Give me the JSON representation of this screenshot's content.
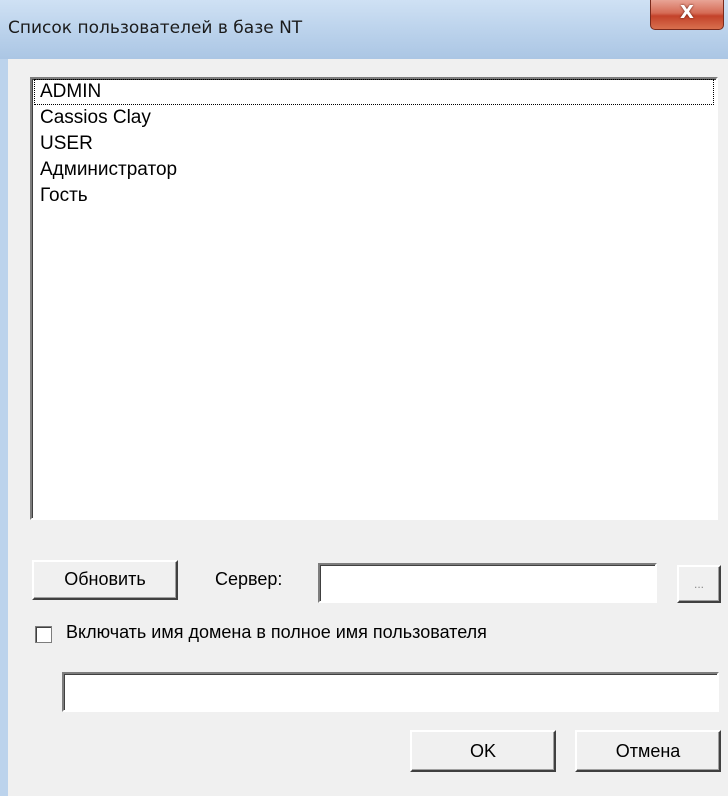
{
  "window": {
    "title": "Список пользователей в базе NT",
    "close_glyph": "X"
  },
  "users": {
    "items": [
      "ADMIN",
      "Cassios Clay",
      "USER",
      "Администратор",
      "Гость"
    ],
    "focused_index": 0
  },
  "controls": {
    "refresh_label": "Обновить",
    "server_label": "Сервер:",
    "server_value": "",
    "browse_label": "...",
    "include_domain_label": "Включать имя домена в полное имя пользователя",
    "include_domain_checked": false,
    "full_name_value": "",
    "ok_label": "OK",
    "cancel_label": "Отмена"
  },
  "colors": {
    "dialog_bg": "#f0f0f0",
    "titlebar": "#bcd3ec",
    "close_button": "#c3422a"
  },
  "icons": {
    "close": "close-icon",
    "checkbox": "checkbox-unchecked"
  }
}
